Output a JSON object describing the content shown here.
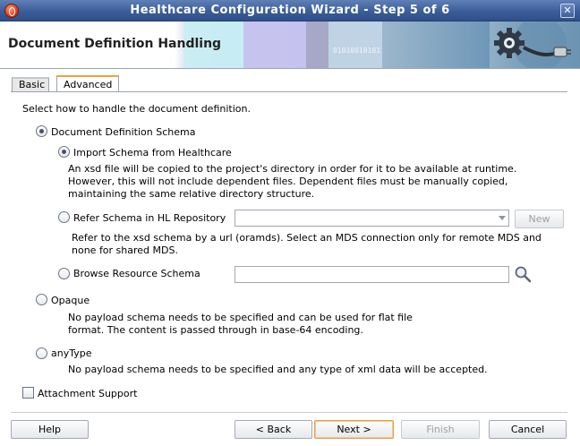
{
  "window": {
    "title": "Healthcare Configuration Wizard - Step 5 of 6",
    "close_glyph": "✕",
    "app_icon": "oracle-icon"
  },
  "banner": {
    "heading": "Document Definition Handling",
    "bits_text": "01010010101",
    "graphic_icon": "gear-plug-icon"
  },
  "tabs": [
    {
      "label": "Basic",
      "selected": false
    },
    {
      "label": "Advanced",
      "selected": true
    }
  ],
  "panel": {
    "instruction": "Select how to handle the document definition.",
    "document_definition_schema": {
      "label": "Document Definition Schema",
      "selected": true,
      "import_schema": {
        "label": "Import Schema from Healthcare",
        "selected": true,
        "description": "An xsd file will be copied to the project's directory in order for it to be available at runtime.  However, this will not include dependent files.  Dependent files must be manually copied, maintaining the same relative directory structure."
      },
      "refer_schema": {
        "label": "Refer Schema in HL Repository",
        "selected": false,
        "combo_value": "",
        "new_button": "New",
        "description": "Refer to the xsd schema by a url (oramds). Select an MDS connection only for remote MDS and none for shared MDS."
      },
      "browse_schema": {
        "label": "Browse Resource Schema",
        "selected": false,
        "field_value": "",
        "search_icon": "search-icon"
      }
    },
    "opaque": {
      "label": "Opaque",
      "selected": false,
      "description": "No payload schema needs to be specified and can be used for flat file format. The content is passed through in base-64 encoding."
    },
    "anytype": {
      "label": "anyType",
      "selected": false,
      "description": "No payload schema needs to be specified and any type of xml data will be accepted."
    },
    "attachment_support": {
      "label": "Attachment Support",
      "checked": false
    }
  },
  "buttons": {
    "help": "Help",
    "back": "< Back",
    "next": "Next >",
    "finish": "Finish",
    "cancel": "Cancel"
  },
  "colors": {
    "titlebar": "#3b5d99",
    "tab_accent": "#f0a23a",
    "default_button_border": "#e0a04a"
  }
}
